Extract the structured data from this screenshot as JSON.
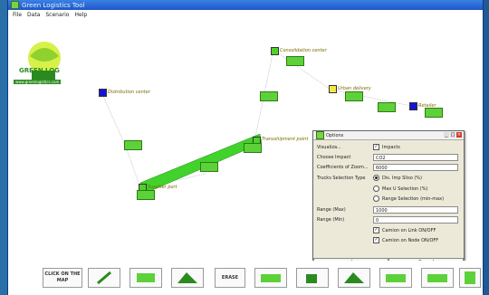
{
  "window": {
    "title": "Green Logistics Tool"
  },
  "menu": [
    "File",
    "Data",
    "Scenario",
    "Help"
  ],
  "logo": {
    "name": "GREEN LOG",
    "url": "www.greenlogistics.com"
  },
  "map": {
    "nodes": [
      {
        "name": "distribution-center",
        "label": "Distribution center",
        "color": "#1414d8"
      },
      {
        "name": "consolidation-center",
        "label": "Consolidation center",
        "color": "#4fd12a"
      },
      {
        "name": "urban-delivery",
        "label": "Urban delivery",
        "color": "#f2e84a"
      },
      {
        "name": "retailer",
        "label": "Retailer",
        "color": "#1414d8"
      },
      {
        "name": "transshipment-point",
        "label": "Transshipment point",
        "color": "#4fd12a"
      },
      {
        "name": "supplier-port",
        "label": "Supplier port",
        "color": "#4fd12a"
      }
    ]
  },
  "options": {
    "title": "Options",
    "visualize_label": "Visualiza...",
    "visualize_value": "Impacts",
    "impact_label": "Choose Impact",
    "impact_value": "CO2",
    "coeff_label": "Coefficients of Zoom...",
    "coeff_value": "6000",
    "selection_label": "Trucks Selection Type",
    "selection_options": [
      "Dis. Imp Sliso (%)",
      "Max U Selection (%)",
      "Range Selection (min-max)"
    ],
    "range_max_label": "Range (Max)",
    "range_max_value": "1000",
    "range_min_label": "Range (Min)",
    "range_min_value": "0",
    "check_link": "Camion on Link ON/OFF",
    "check_node": "Camion on Node ON/OFF",
    "ok_label": "ok",
    "cancel_label": "Cancel"
  },
  "toolbar": {
    "click_map": "CLICK ON THE MAP",
    "erase": "ERASE"
  }
}
